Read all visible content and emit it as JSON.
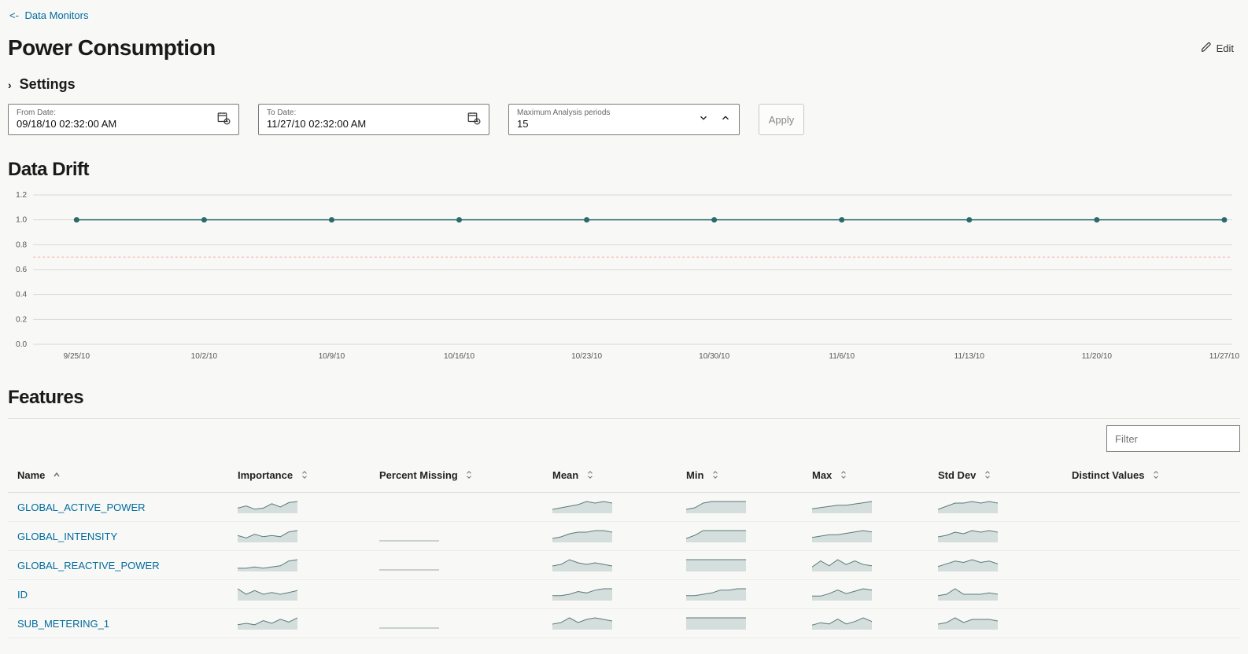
{
  "breadcrumb": {
    "arrow": "<-",
    "label": "Data Monitors"
  },
  "page_title": "Power Consumption",
  "edit_label": "Edit",
  "settings": {
    "label": "Settings"
  },
  "filters": {
    "from": {
      "label": "From Date:",
      "value": "09/18/10 02:32:00 AM"
    },
    "to": {
      "label": "To Date:",
      "value": "11/27/10 02:32:00 AM"
    },
    "periods": {
      "label": "Maximum Analysis periods",
      "value": "15"
    },
    "apply": "Apply"
  },
  "sections": {
    "drift": "Data Drift",
    "features": "Features"
  },
  "chart_data": {
    "type": "line",
    "title": "",
    "xlabel": "",
    "ylabel": "",
    "ylim": [
      0.0,
      1.2
    ],
    "yticks": [
      0.0,
      0.2,
      0.4,
      0.6,
      0.8,
      1.0,
      1.2
    ],
    "threshold": 0.7,
    "categories": [
      "9/25/10",
      "10/2/10",
      "10/9/10",
      "10/16/10",
      "10/23/10",
      "10/30/10",
      "11/6/10",
      "11/13/10",
      "11/20/10",
      "11/27/10"
    ],
    "series": [
      {
        "name": "drift",
        "values": [
          1.0,
          1.0,
          1.0,
          1.0,
          1.0,
          1.0,
          1.0,
          1.0,
          1.0,
          1.0
        ]
      }
    ]
  },
  "table": {
    "filter_placeholder": "Filter",
    "columns": {
      "name": "Name",
      "importance": "Importance",
      "pct_missing": "Percent Missing",
      "mean": "Mean",
      "min": "Min",
      "max": "Max",
      "stddev": "Std Dev",
      "distinct": "Distinct Values"
    },
    "rows": [
      {
        "name": "GLOBAL_ACTIVE_POWER",
        "importance": [
          4,
          6,
          3,
          4,
          8,
          5,
          9,
          10
        ],
        "pct_missing": null,
        "mean": [
          2,
          3,
          4,
          5,
          7,
          6,
          7,
          6
        ],
        "min": [
          2,
          3,
          6,
          7,
          7,
          7,
          7,
          7
        ],
        "max": [
          3,
          4,
          5,
          6,
          6,
          7,
          8,
          9
        ],
        "stddev": [
          2,
          4,
          6,
          6,
          7,
          6,
          7,
          6
        ]
      },
      {
        "name": "GLOBAL_INTENSITY",
        "importance": [
          5,
          3,
          6,
          4,
          5,
          4,
          8,
          9
        ],
        "pct_missing": [
          1,
          1,
          1,
          1,
          1,
          1,
          1,
          1
        ],
        "mean": [
          2,
          3,
          5,
          6,
          6,
          7,
          7,
          6
        ],
        "min": [
          2,
          4,
          7,
          7,
          7,
          7,
          7,
          7
        ],
        "max": [
          3,
          4,
          5,
          5,
          6,
          7,
          8,
          7
        ],
        "stddev": [
          3,
          4,
          6,
          5,
          7,
          6,
          7,
          6
        ]
      },
      {
        "name": "GLOBAL_REACTIVE_POWER",
        "importance": [
          2,
          2,
          3,
          2,
          3,
          4,
          8,
          9
        ],
        "pct_missing": [
          1,
          1,
          1,
          1,
          1,
          1,
          1,
          1
        ],
        "mean": [
          3,
          4,
          7,
          5,
          4,
          5,
          4,
          3
        ],
        "min": [
          1,
          1,
          1,
          1,
          1,
          1,
          1,
          1
        ],
        "max": [
          3,
          8,
          4,
          9,
          5,
          8,
          5,
          4
        ],
        "stddev": [
          3,
          5,
          7,
          6,
          8,
          6,
          7,
          5
        ]
      },
      {
        "name": "ID",
        "importance": [
          6,
          3,
          5,
          3,
          4,
          3,
          4,
          5
        ],
        "pct_missing": null,
        "mean": [
          3,
          3,
          4,
          6,
          5,
          7,
          8,
          8
        ],
        "min": [
          3,
          3,
          4,
          5,
          7,
          7,
          8,
          8
        ],
        "max": [
          3,
          3,
          5,
          8,
          5,
          7,
          9,
          8
        ],
        "stddev": [
          3,
          4,
          8,
          4,
          4,
          4,
          5,
          4
        ]
      },
      {
        "name": "SUB_METERING_1",
        "importance": [
          3,
          4,
          3,
          6,
          4,
          7,
          5,
          8
        ],
        "pct_missing": [
          1,
          1,
          1,
          1,
          1,
          1,
          1,
          1
        ],
        "mean": [
          3,
          4,
          7,
          4,
          6,
          7,
          6,
          5
        ],
        "min": [
          1,
          1,
          1,
          1,
          1,
          1,
          1,
          1
        ],
        "max": [
          3,
          5,
          4,
          8,
          4,
          6,
          9,
          6
        ],
        "stddev": [
          3,
          4,
          7,
          4,
          6,
          6,
          6,
          5
        ]
      }
    ]
  }
}
